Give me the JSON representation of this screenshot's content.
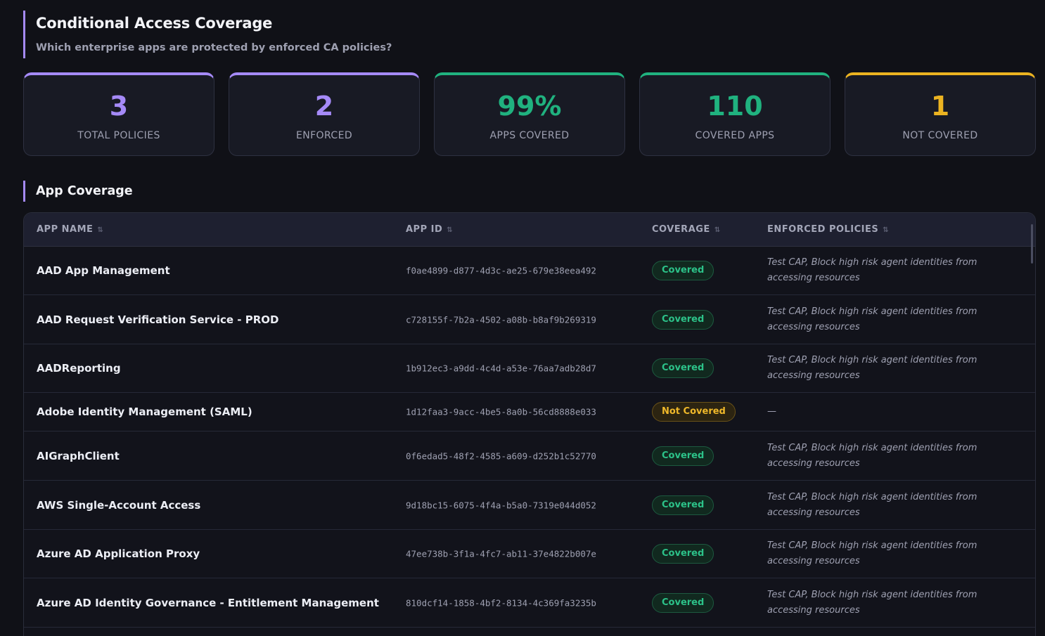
{
  "header": {
    "title": "Conditional Access Coverage",
    "subtitle": "Which enterprise apps are protected by enforced CA policies?",
    "accent": "#a58af7"
  },
  "stats": [
    {
      "value": "3",
      "label": "TOTAL POLICIES",
      "color": "#a58af7"
    },
    {
      "value": "2",
      "label": "ENFORCED",
      "color": "#a58af7"
    },
    {
      "value": "99%",
      "label": "APPS COVERED",
      "color": "#20b27f"
    },
    {
      "value": "110",
      "label": "COVERED APPS",
      "color": "#20b27f"
    },
    {
      "value": "1",
      "label": "NOT COVERED",
      "color": "#ebb321"
    }
  ],
  "section": {
    "title": "App Coverage"
  },
  "table": {
    "columns": [
      {
        "label": "APP NAME",
        "sort_icon": "sort-icon"
      },
      {
        "label": "APP ID",
        "sort_icon": "sort-icon"
      },
      {
        "label": "COVERAGE",
        "sort_icon": "sort-icon"
      },
      {
        "label": "ENFORCED POLICIES",
        "sort_icon": "sort-icon"
      }
    ],
    "rows": [
      {
        "name": "AAD App Management",
        "app_id": "f0ae4899-d877-4d3c-ae25-679e38eea492",
        "coverage": "Covered",
        "status": "ok",
        "policies": "Test CAP, Block high risk agent identities from accessing resources"
      },
      {
        "name": "AAD Request Verification Service - PROD",
        "app_id": "c728155f-7b2a-4502-a08b-b8af9b269319",
        "coverage": "Covered",
        "status": "ok",
        "policies": "Test CAP, Block high risk agent identities from accessing resources"
      },
      {
        "name": "AADReporting",
        "app_id": "1b912ec3-a9dd-4c4d-a53e-76aa7adb28d7",
        "coverage": "Covered",
        "status": "ok",
        "policies": "Test CAP, Block high risk agent identities from accessing resources"
      },
      {
        "name": "Adobe Identity Management (SAML)",
        "app_id": "1d12faa3-9acc-4be5-8a0b-56cd8888e033",
        "coverage": "Not Covered",
        "status": "no",
        "policies": "—"
      },
      {
        "name": "AIGraphClient",
        "app_id": "0f6edad5-48f2-4585-a609-d252b1c52770",
        "coverage": "Covered",
        "status": "ok",
        "policies": "Test CAP, Block high risk agent identities from accessing resources"
      },
      {
        "name": "AWS Single-Account Access",
        "app_id": "9d18bc15-6075-4f4a-b5a0-7319e044d052",
        "coverage": "Covered",
        "status": "ok",
        "policies": "Test CAP, Block high risk agent identities from accessing resources"
      },
      {
        "name": "Azure AD Application Proxy",
        "app_id": "47ee738b-3f1a-4fc7-ab11-37e4822b007e",
        "coverage": "Covered",
        "status": "ok",
        "policies": "Test CAP, Block high risk agent identities from accessing resources"
      },
      {
        "name": "Azure AD Identity Governance - Entitlement Management",
        "app_id": "810dcf14-1858-4bf2-8134-4c369fa3235b",
        "coverage": "Covered",
        "status": "ok",
        "policies": "Test CAP, Block high risk agent identities from accessing resources"
      }
    ]
  }
}
